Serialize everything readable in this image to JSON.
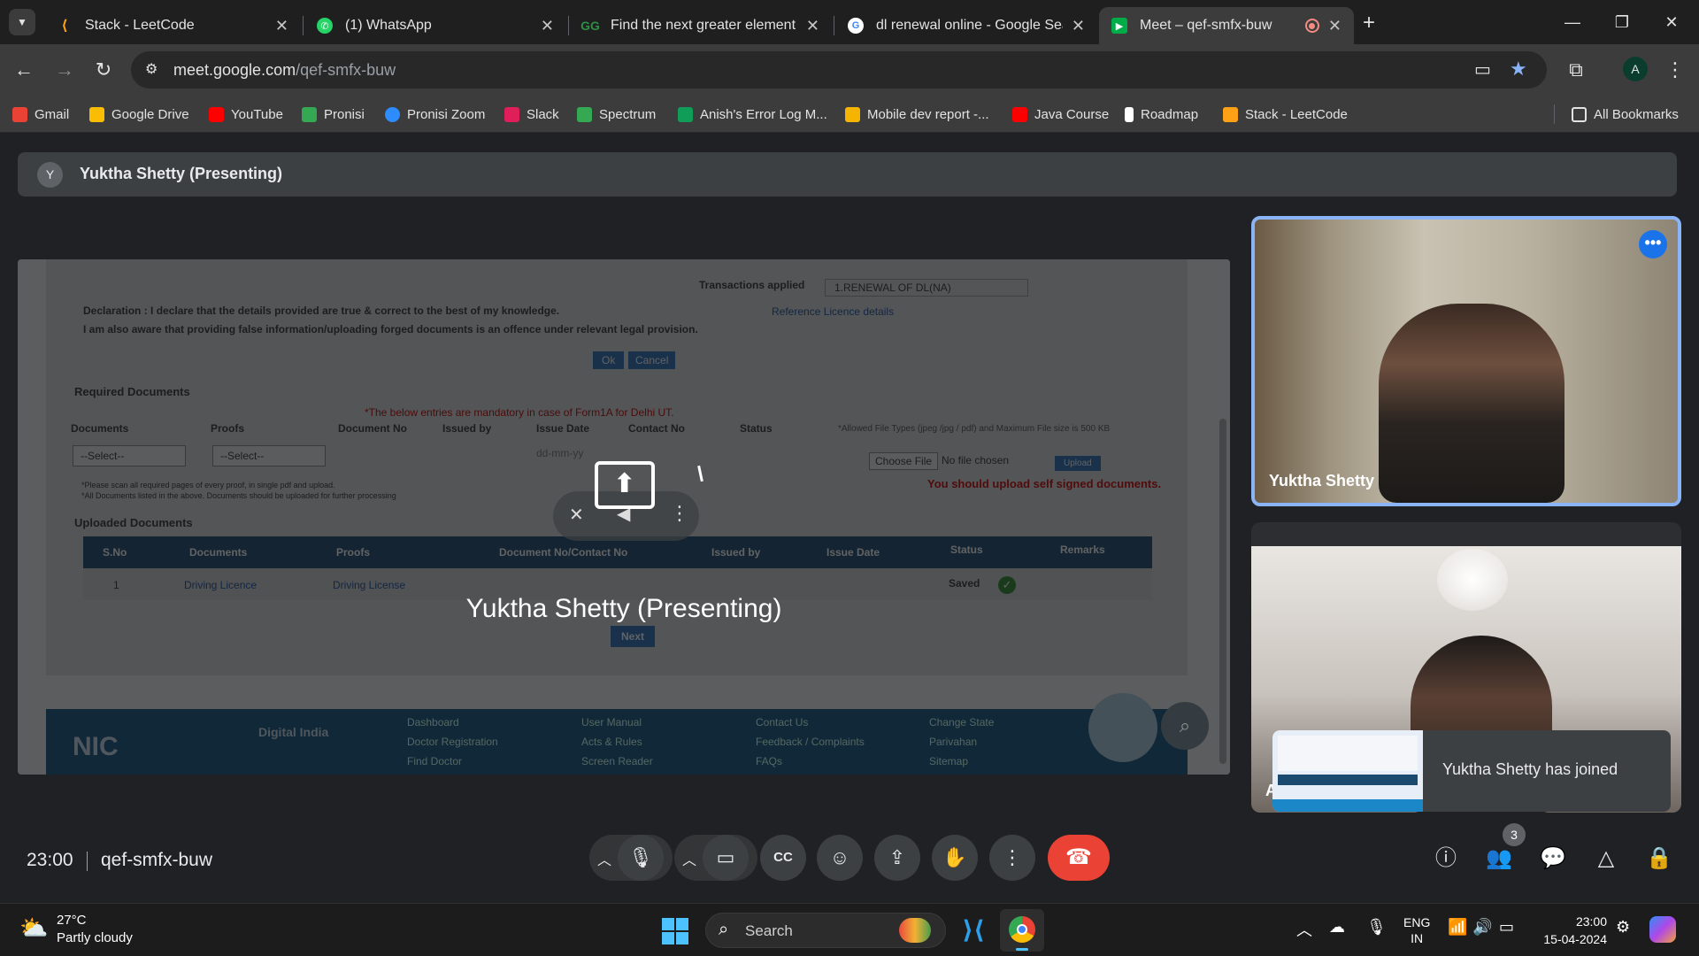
{
  "browser": {
    "tabs": [
      {
        "title": "Stack - LeetCode",
        "favicon": "leetcode-icon",
        "color": "#ffa116",
        "active": false
      },
      {
        "title": "(1) WhatsApp",
        "favicon": "whatsapp-icon",
        "color": "#25d366",
        "active": false
      },
      {
        "title": "Find the next greater element in",
        "favicon": "gfg-icon",
        "color": "#2f8d46",
        "active": false
      },
      {
        "title": "dl renewal online - Google Sear",
        "favicon": "google-icon",
        "color": "#4285f4",
        "active": false
      },
      {
        "title": "Meet – qef-smfx-buw",
        "favicon": "meet-icon",
        "color": "#00ac47",
        "active": true
      }
    ],
    "url": {
      "host": "meet.google.com",
      "path": "/qef-smfx-buw"
    },
    "profile_initial": "A",
    "bookmarks": [
      {
        "label": "Gmail",
        "color": "#ea4335"
      },
      {
        "label": "Google Drive",
        "color": "#fbbc04"
      },
      {
        "label": "YouTube",
        "color": "#ff0000"
      },
      {
        "label": "Pronisi",
        "color": "#34a853"
      },
      {
        "label": "Pronisi Zoom",
        "color": "#2d8cff"
      },
      {
        "label": "Slack",
        "color": "#e01e5a"
      },
      {
        "label": "Spectrum",
        "color": "#34a853"
      },
      {
        "label": "Anish's Error Log M...",
        "color": "#0f9d58"
      },
      {
        "label": "Mobile dev report -...",
        "color": "#f4b400"
      },
      {
        "label": "Java Course",
        "color": "#ff0000"
      },
      {
        "label": "Roadmap",
        "color": "#ffffff"
      },
      {
        "label": "Stack - LeetCode",
        "color": "#ffa116"
      }
    ],
    "all_bookmarks": "All Bookmarks"
  },
  "meet": {
    "presenter_initial": "Y",
    "presenter_banner": "Yuktha Shetty (Presenting)",
    "screen_overlay_name": "Yuktha Shetty (Presenting)",
    "shared_page": {
      "transactions_label": "Transactions applied",
      "transactions_value": "1.RENEWAL OF DL(NA)",
      "declaration": "Declaration : I declare that the details provided are true & correct to the best of my knowledge.",
      "awareness": "I am also aware that providing false information/uploading forged documents is an offence under relevant legal provision.",
      "reference_link": "Reference Licence details",
      "ok": "Ok",
      "cancel": "Cancel",
      "required_docs": "Required Documents",
      "mandatory_note": "*The below entries are mandatory in case of Form1A for Delhi UT.",
      "columns": [
        "Documents",
        "Proofs",
        "Document No",
        "Issued by",
        "Issue Date",
        "Contact No",
        "Status"
      ],
      "select": "--Select--",
      "date_placeholder": "dd-mm-yy",
      "allowed_types": "*Allowed File Types (jpeg /jpg / pdf) and Maximum File size is 500 KB",
      "choose_file": "Choose File",
      "no_file": "No file chosen",
      "upload": "Upload",
      "self_signed": "You should upload self signed documents.",
      "scan_note1": "*Please scan all required pages of every proof, in single pdf and upload.",
      "scan_note2": "*All Documents listed in the above. Documents should be uploaded for further processing",
      "uploaded_docs": "Uploaded Documents",
      "table_headers": [
        "S.No",
        "Documents",
        "Proofs",
        "Document No/Contact No",
        "Issued by",
        "Issue Date",
        "Status",
        "Remarks"
      ],
      "table_rows": [
        [
          "1",
          "Driving Licence",
          "Driving License",
          "",
          "",
          "",
          "Saved",
          ""
        ]
      ],
      "next": "Next",
      "footer_links": [
        "Dashboard",
        "Doctor Registration",
        "Find Doctor",
        "User Manual",
        "Acts & Rules",
        "Screen Reader",
        "Contact Us",
        "Feedback / Complaints",
        "FAQs",
        "Change State",
        "Parivahan",
        "Sitemap"
      ]
    },
    "tiles": [
      {
        "name": "Yuktha Shetty"
      },
      {
        "name": "A"
      }
    ],
    "toast": "Yuktha Shetty has joined",
    "time": "23:00",
    "meeting_code": "qef-smfx-buw",
    "people_count": "3",
    "end_call_color": "#ea4335"
  },
  "taskbar": {
    "temperature": "27°C",
    "condition": "Partly cloudy",
    "search": "Search",
    "lang1": "ENG",
    "lang2": "IN",
    "time": "23:00",
    "date": "15-04-2024"
  }
}
